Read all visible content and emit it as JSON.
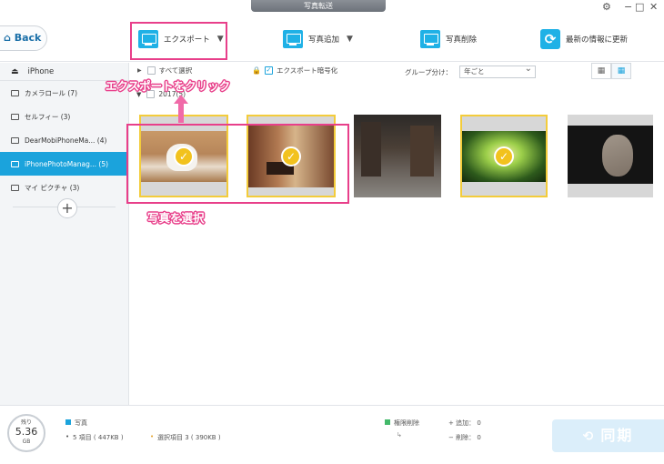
{
  "window": {
    "title": "写真転送"
  },
  "toolbar": {
    "back_label": "Back",
    "export_label": "エクスポート",
    "add_label": "写真追加",
    "delete_label": "写真削除",
    "refresh_label": "最新の情報に更新"
  },
  "sidebar": {
    "device_name": "iPhone",
    "items": [
      {
        "label": "カメラロール (7)"
      },
      {
        "label": "セルフィー (3)"
      },
      {
        "label": "DearMobiPhoneMa... (4)"
      },
      {
        "label": "iPhonePhotoManag... (5)"
      },
      {
        "label": "マイ ピクチャ (3)"
      }
    ],
    "add_symbol": "+"
  },
  "filter": {
    "select_all": "すべて選択",
    "encrypt_export": "エクスポート暗号化",
    "group_label": "グループ分け：",
    "group_value": "年ごと",
    "date_header": "2017(5)"
  },
  "annotations": {
    "export_hint": "エクスポートをクリック",
    "select_hint": "写真を選択",
    "color": "#e83f8a"
  },
  "photos": [
    {
      "subject": "kitten",
      "selected": true
    },
    {
      "subject": "piano-room",
      "selected": true
    },
    {
      "subject": "street-night",
      "selected": false
    },
    {
      "subject": "forest-sunset",
      "selected": true
    },
    {
      "subject": "squirrel",
      "selected": false
    }
  ],
  "status": {
    "storage_label": "残り",
    "storage_value": "5.36",
    "storage_unit": "GB",
    "category": "写真",
    "items_count": "5 項目 ( 447KB )",
    "selected_items": "選択項目 3 ( 390KB )",
    "perm_delete": "権限削除",
    "add_count": "+ 追加： 0",
    "remove_count": "− 削除： 0",
    "sync_label": "同期"
  },
  "colors": {
    "accent": "#1ba3dc",
    "selection": "#f3cc3b",
    "annotation": "#e83f8a"
  }
}
